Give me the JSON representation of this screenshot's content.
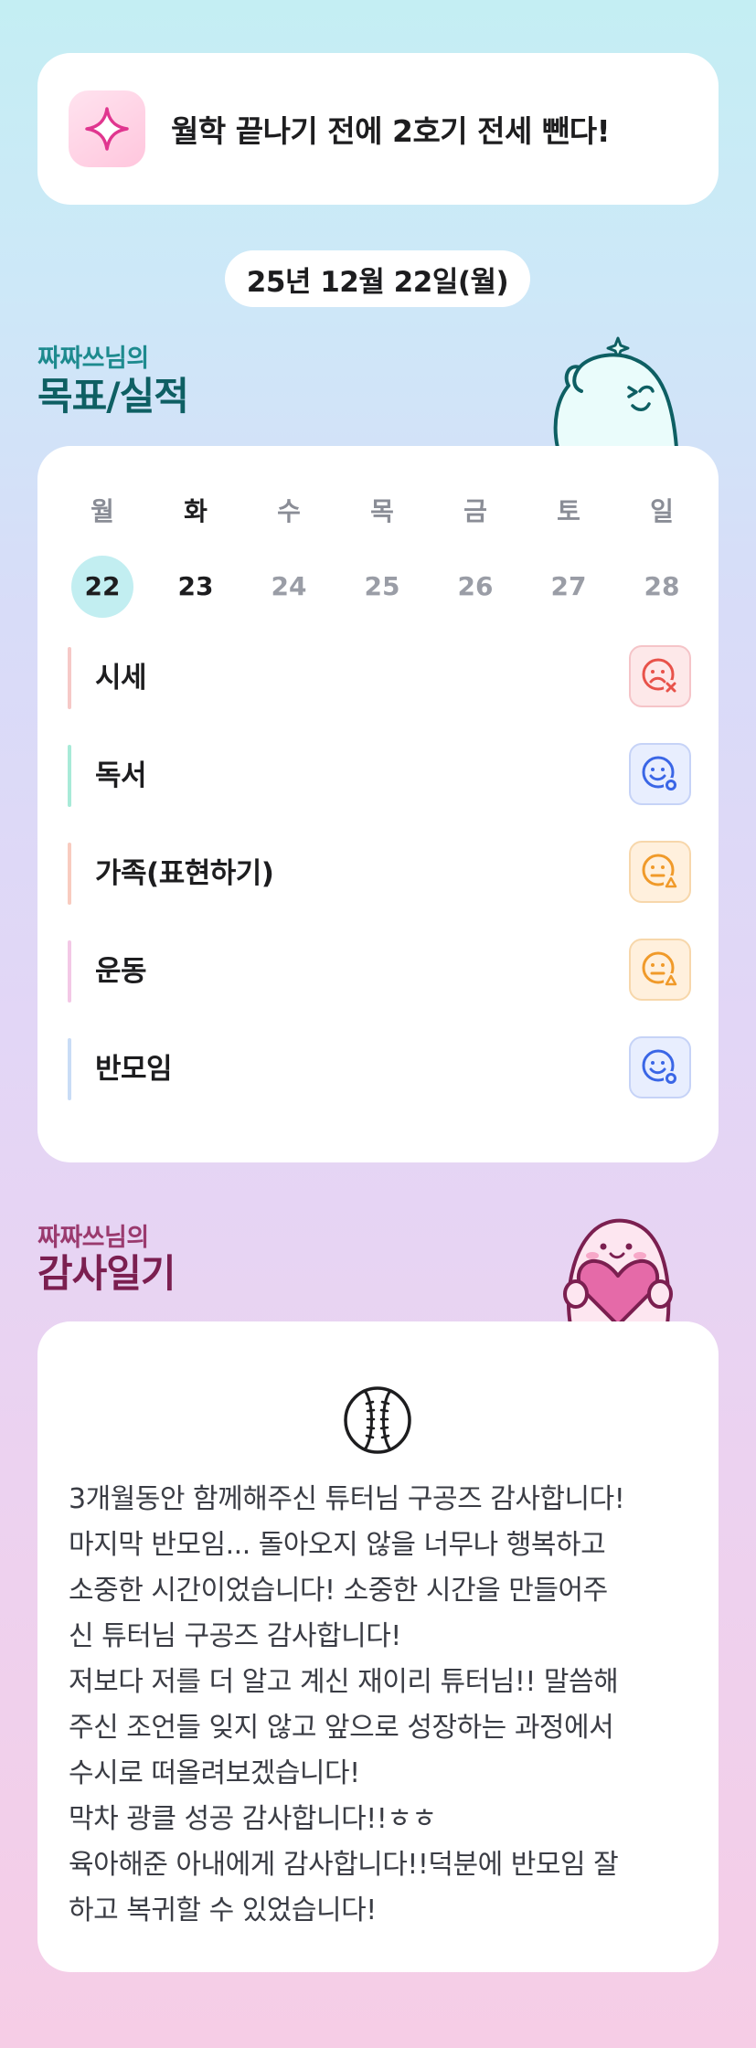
{
  "goal_banner": {
    "icon": "sparkle-icon",
    "text": "월학 끝나기 전에 2호기 전세 뺀다!"
  },
  "date": "25년 12월 22일(월)",
  "goals_section": {
    "owner": "짜짜쓰님의",
    "title": "목표/실적"
  },
  "week": [
    {
      "day": "월",
      "date": "22",
      "selected": true
    },
    {
      "day": "화",
      "date": "23",
      "today": true
    },
    {
      "day": "수",
      "date": "24"
    },
    {
      "day": "목",
      "date": "25"
    },
    {
      "day": "금",
      "date": "26"
    },
    {
      "day": "토",
      "date": "27"
    },
    {
      "day": "일",
      "date": "28"
    }
  ],
  "goals": [
    {
      "label": "시세",
      "bar_color": "#f6c9c7",
      "status": "sad-x-face-icon",
      "status_color": "#e8524a"
    },
    {
      "label": "독서",
      "bar_color": "#a8ead8",
      "status": "smile-o-face-icon",
      "status_color": "#3a66e6"
    },
    {
      "label": "가족(표현하기)",
      "bar_color": "#f8cbbf",
      "status": "neutral-triangle-face-icon",
      "status_color": "#f09a2a"
    },
    {
      "label": "운동",
      "bar_color": "#f3c8e6",
      "status": "neutral-triangle-face-icon",
      "status_color": "#f09a2a"
    },
    {
      "label": "반모임",
      "bar_color": "#c9dcf6",
      "status": "smile-o-face-icon",
      "status_color": "#3a66e6"
    }
  ],
  "thanks_section": {
    "owner": "짜짜쓰님의",
    "title": "감사일기"
  },
  "thanks": {
    "icon": "baseball-icon",
    "text": "3개월동안 함께해주신 튜터님 구공즈 감사합니다!\n마지막 반모임... 돌아오지 않을 너무나 행복하고\n소중한 시간이었습니다! 소중한 시간을 만들어주\n신 튜터님 구공즈 감사합니다!\n저보다 저를 더 알고 계신 재이리 튜터님!! 말씀해\n주신 조언들 잊지 않고 앞으로 성장하는 과정에서\n수시로 떠올려보겠습니다!\n막차 광클 성공 감사합니다!!ㅎㅎ\n육아해준 아내에게 감사합니다!!덕분에 반모임 잘\n하고 복귀할 수 있었습니다!"
  }
}
